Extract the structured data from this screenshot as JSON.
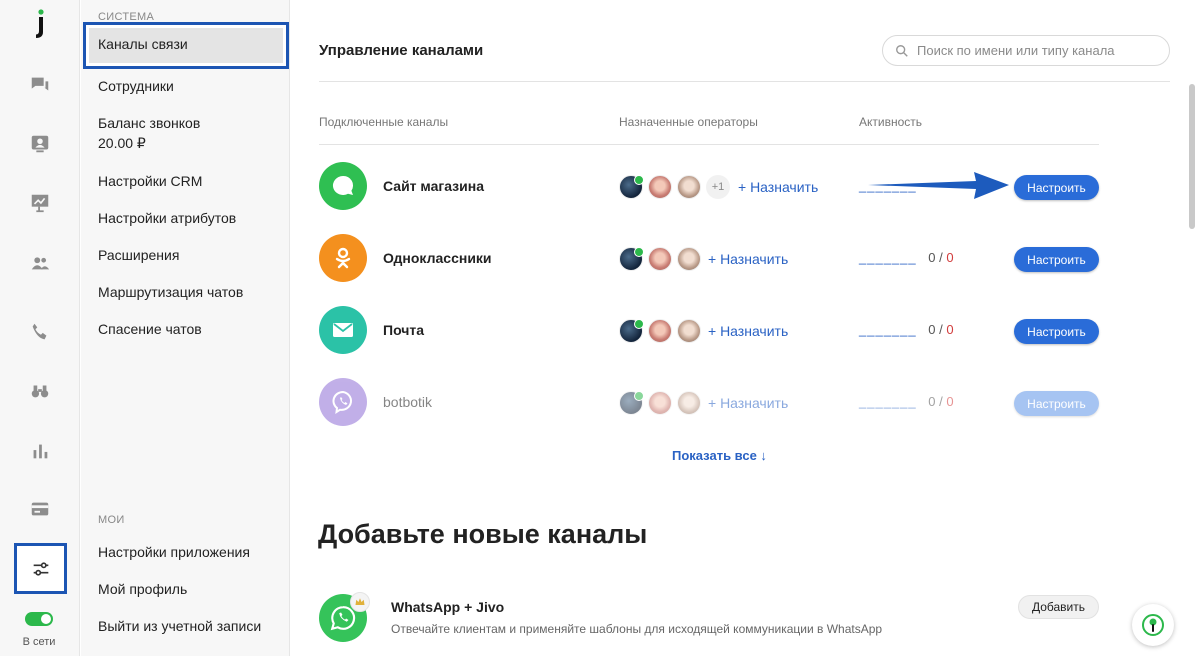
{
  "rail": {
    "logo": "j",
    "online_label": "В сети",
    "icons": [
      "chat-icon",
      "visitor-icon",
      "presentation-icon",
      "users-icon",
      "phone-icon",
      "binoculars-icon",
      "analytics-icon",
      "billing-card-icon",
      "settings-sliders-icon"
    ]
  },
  "sidebar": {
    "section_system": "СИСТЕМА",
    "section_my": "МОИ",
    "system_items": [
      {
        "label": "Каналы связи"
      },
      {
        "label": "Сотрудники"
      },
      {
        "label": "Баланс звонков"
      },
      {
        "label": "Настройки CRM"
      },
      {
        "label": "Настройки атрибутов"
      },
      {
        "label": "Расширения"
      },
      {
        "label": "Маршрутизация чатов"
      },
      {
        "label": "Спасение чатов"
      }
    ],
    "balance_value": "20.00 ₽",
    "my_items": [
      {
        "label": "Настройки приложения"
      },
      {
        "label": "Мой профиль"
      },
      {
        "label": "Выйти из учетной записи"
      }
    ]
  },
  "main": {
    "title": "Управление каналами",
    "search_placeholder": "Поиск по имени или типу канала",
    "columns": {
      "channels": "Подключенные каналы",
      "operators": "Назначенные операторы",
      "activity": "Активность"
    },
    "channels": [
      {
        "name": "Сайт магазина",
        "icon": "chat-bubble-icon",
        "color": "#2fbf52",
        "extra_operators": "+1",
        "assign": "+ Назначить",
        "activity": "",
        "configure": "Настроить"
      },
      {
        "name": "Одноклассники",
        "icon": "odnoklassniki-icon",
        "color": "#f4901e",
        "extra_operators": "",
        "assign": "+ Назначить",
        "activity": "0",
        "activity_total": "0",
        "configure": "Настроить"
      },
      {
        "name": "Почта",
        "icon": "mail-icon",
        "color": "#2bc2a7",
        "extra_operators": "",
        "assign": "+ Назначить",
        "activity": "0",
        "activity_total": "0",
        "configure": "Настроить"
      },
      {
        "name": "botbotik",
        "icon": "viber-icon",
        "color": "#8f6fd6",
        "extra_operators": "",
        "assign": "+ Назначить",
        "activity": "0",
        "activity_total": "0",
        "configure": "Настроить"
      }
    ],
    "activity_placeholder": "_______",
    "show_all": "Показать все ↓",
    "add_title": "Добавьте новые каналы",
    "new_channels": [
      {
        "name": "WhatsApp + Jivo",
        "description": "Отвечайте клиентам и применяйте шаблоны для исходящей коммуникации в WhatsApp",
        "button": "Добавить",
        "icon": "whatsapp-icon",
        "badge": "crown-icon"
      }
    ]
  }
}
